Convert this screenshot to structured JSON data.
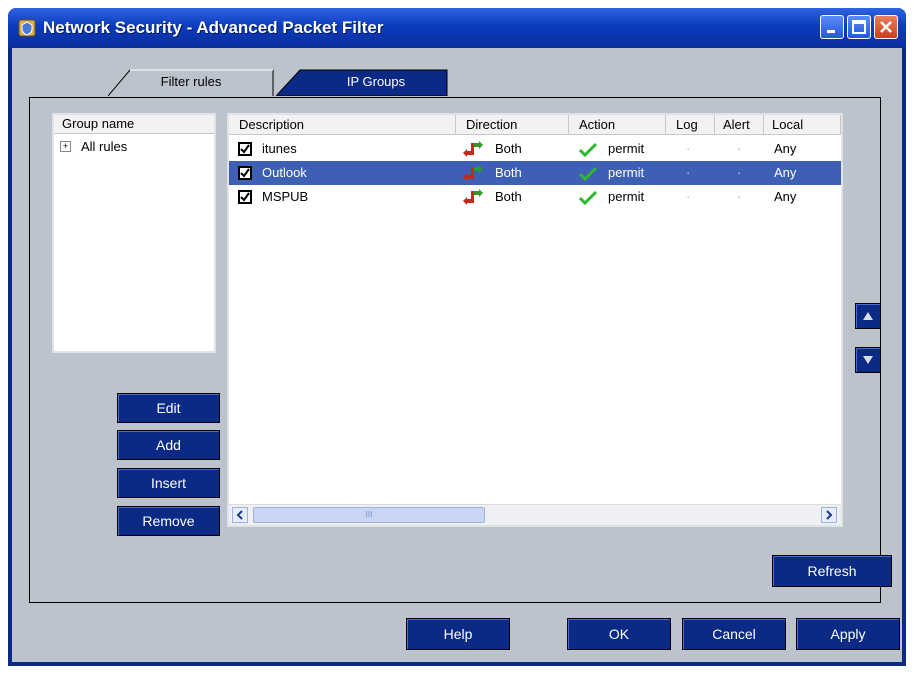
{
  "window": {
    "title": "Network Security - Advanced Packet Filter"
  },
  "tabs": [
    {
      "label": "Filter rules",
      "active": true
    },
    {
      "label": "IP Groups",
      "active": false
    }
  ],
  "group_panel": {
    "header": "Group name",
    "items": [
      {
        "label": "All rules",
        "expander": "+"
      }
    ]
  },
  "rule_buttons": {
    "edit": "Edit",
    "add": "Add",
    "insert": "Insert",
    "remove": "Remove"
  },
  "rules_table": {
    "columns": [
      "Description",
      "Direction",
      "Action",
      "Log",
      "Alert",
      "Local"
    ],
    "rows": [
      {
        "enabled": true,
        "description": "itunes",
        "direction": "Both",
        "action": "permit",
        "log": "·",
        "alert": "·",
        "local": "Any",
        "selected": false
      },
      {
        "enabled": true,
        "description": "Outlook",
        "direction": "Both",
        "action": "permit",
        "log": "·",
        "alert": "·",
        "local": "Any",
        "selected": true
      },
      {
        "enabled": true,
        "description": "MSPUB",
        "direction": "Both",
        "action": "permit",
        "log": "·",
        "alert": "·",
        "local": "Any",
        "selected": false
      }
    ]
  },
  "scrollbar": {
    "grip": "III"
  },
  "refresh_label": "Refresh",
  "footer": {
    "help": "Help",
    "ok": "OK",
    "cancel": "Cancel",
    "apply": "Apply"
  },
  "colors": {
    "accent": "#0a2a86",
    "selection": "#3d5fb4",
    "background": "#bcc3cc"
  }
}
